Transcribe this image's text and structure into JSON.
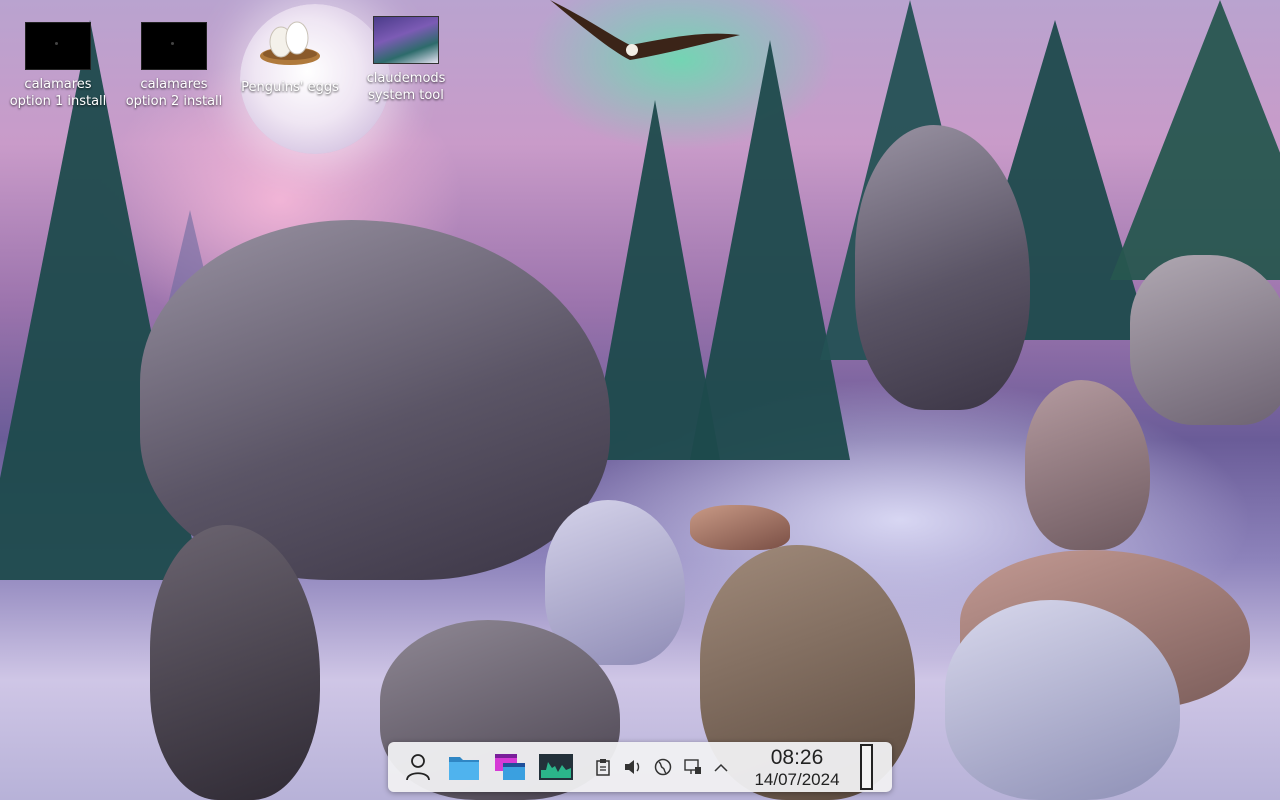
{
  "desktop": {
    "wallpaper_theme": "Winter wolves under aurora",
    "icons": [
      {
        "label_line1": "calamares",
        "label_line2": "option 1 install",
        "icon": "black-screen-thumbnail"
      },
      {
        "label_line1": "calamares",
        "label_line2": "option 2 install",
        "icon": "black-screen-thumbnail"
      },
      {
        "label_line1": "Penguins' eggs",
        "label_line2": "",
        "icon": "eggs-nest-icon"
      },
      {
        "label_line1": "claudemods",
        "label_line2": "system tool",
        "icon": "artwork-thumbnail"
      }
    ]
  },
  "taskbar": {
    "launchers": [
      {
        "name": "user-menu",
        "icon": "user-icon"
      },
      {
        "name": "file-manager",
        "icon": "folder-icon"
      },
      {
        "name": "window-switcher",
        "icon": "windows-icon"
      },
      {
        "name": "system-monitor",
        "icon": "system-monitor-icon"
      }
    ],
    "tray": [
      "clipboard-icon",
      "volume-icon",
      "network-globe-icon",
      "display-network-icon",
      "chevron-up-icon"
    ],
    "clock": {
      "time": "08:26",
      "date": "14/07/2024"
    }
  },
  "colors": {
    "taskbar_bg": "#f0f0f2",
    "folder_blue": "#3aa0e0",
    "accent_magenta": "#d63ad6",
    "monitor_green": "#2bb58a"
  }
}
